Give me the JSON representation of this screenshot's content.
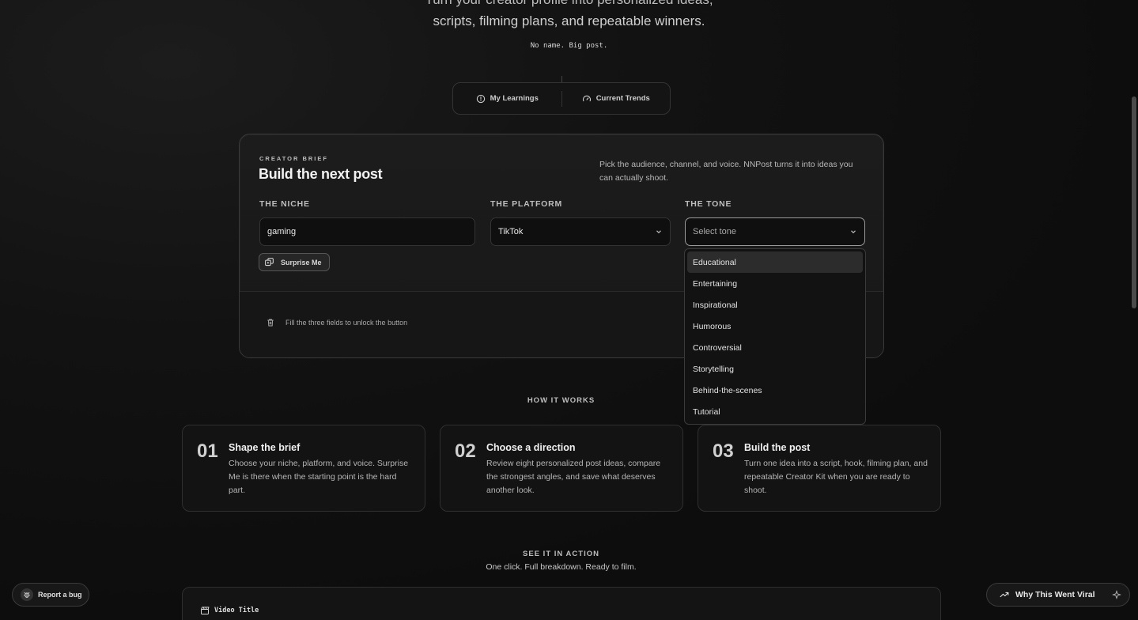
{
  "hero": {
    "line1": "Turn your creator profile into personalized ideas,",
    "line2": "scripts, filming plans, and repeatable winners.",
    "tagline": "No name. Big post."
  },
  "nav": {
    "learnings": "My Learnings",
    "trends": "Current Trends"
  },
  "brief": {
    "eyebrow": "CREATOR BRIEF",
    "title": "Build the next post",
    "description": "Pick the audience, channel, and voice. NNPost turns it into ideas you can actually shoot.",
    "niche_label": "THE NICHE",
    "niche_value": "gaming",
    "platform_label": "THE PLATFORM",
    "platform_value": "TikTok",
    "tone_label": "THE TONE",
    "tone_placeholder": "Select tone",
    "surprise_label": "Surprise Me",
    "footer_note": "Fill the three fields to unlock the button"
  },
  "tone_options": [
    "Educational",
    "Entertaining",
    "Inspirational",
    "Humorous",
    "Controversial",
    "Storytelling",
    "Behind-the-scenes",
    "Tutorial"
  ],
  "how_it_works": {
    "title": "HOW IT WORKS",
    "steps": [
      {
        "num": "01",
        "title": "Shape the brief",
        "desc": "Choose your niche, platform, and voice. Surprise Me is there when the starting point is the hard part."
      },
      {
        "num": "02",
        "title": "Choose a direction",
        "desc": "Review eight personalized post ideas, compare the strongest angles, and save what deserves another look."
      },
      {
        "num": "03",
        "title": "Build the post",
        "desc": "Turn one idea into a script, hook, filming plan, and repeatable Creator Kit when you are ready to shoot."
      }
    ]
  },
  "see_it": {
    "title": "SEE IT IN ACTION",
    "subtitle": "One click. Full breakdown. Ready to film.",
    "demo_label": "Video Title"
  },
  "floating": {
    "bug": "Report a bug",
    "viral": "Why This Went Viral"
  }
}
